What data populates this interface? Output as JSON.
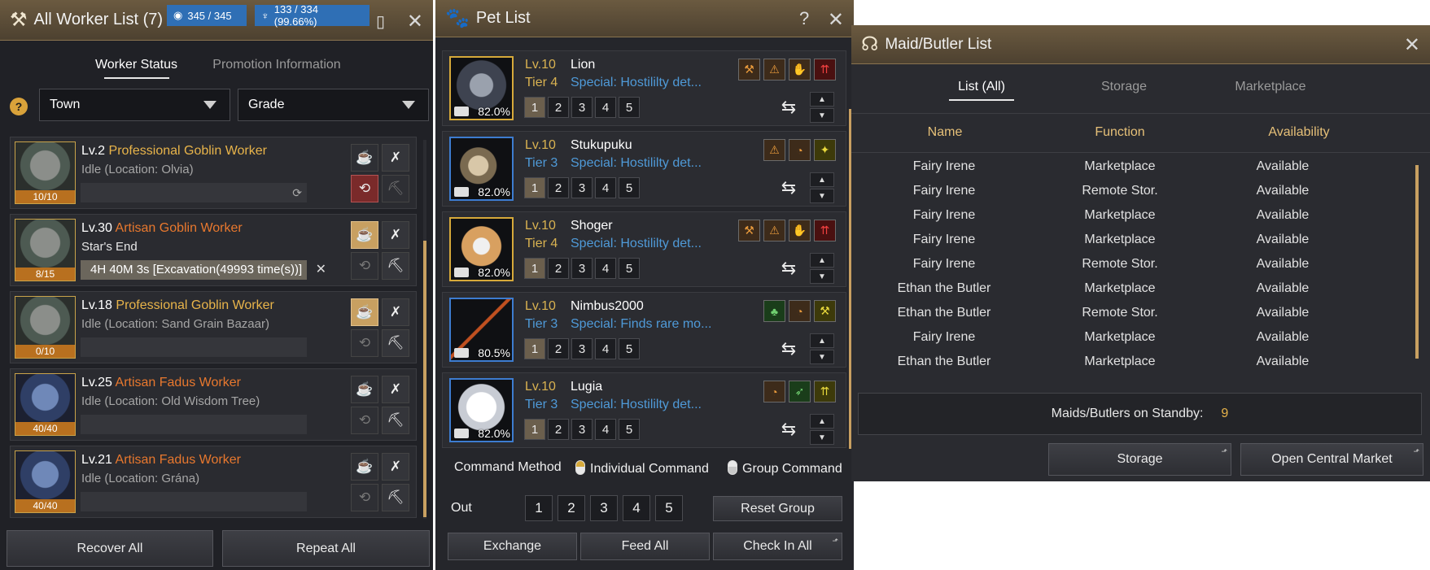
{
  "worker": {
    "title": "All Worker List (7)",
    "energy": "345 / 345",
    "stamina": "133 / 334 (99.66%)",
    "tabs": [
      "Worker Status",
      "Promotion Information"
    ],
    "filter_town": "Town",
    "filter_grade": "Grade",
    "help": "?",
    "rows": [
      {
        "lv": "Lv.2",
        "name": "Professional Goblin Worker",
        "status": "Idle (Location: Olvia)",
        "count": "10/10",
        "job": ""
      },
      {
        "lv": "Lv.30",
        "name": "Artisan Goblin Worker",
        "status": "Star's End",
        "count": "8/15",
        "job": "4H 40M 3s [Excavation(49993 time(s))]"
      },
      {
        "lv": "Lv.18",
        "name": "Professional Goblin Worker",
        "status": "Idle (Location: Sand Grain Bazaar)",
        "count": "0/10",
        "job": ""
      },
      {
        "lv": "Lv.25",
        "name": "Artisan Fadus Worker",
        "status": "Idle (Location: Old Wisdom Tree)",
        "count": "40/40",
        "job": ""
      },
      {
        "lv": "Lv.21",
        "name": "Artisan Fadus Worker",
        "status": "Idle (Location: Grána)",
        "count": "40/40",
        "job": ""
      }
    ],
    "recover_all": "Recover All",
    "repeat_all": "Repeat All"
  },
  "pet": {
    "title": "Pet List",
    "help": "?",
    "pets": [
      {
        "lv": "Lv.10",
        "name": "Lion",
        "tier": "Tier 4",
        "special": "Special: Hostililty det...",
        "pct": "82.0%"
      },
      {
        "lv": "Lv.10",
        "name": "Stukupuku",
        "tier": "Tier 3",
        "special": "Special: Hostililty det...",
        "pct": "82.0%"
      },
      {
        "lv": "Lv.10",
        "name": "Shoger",
        "tier": "Tier 4",
        "special": "Special: Hostililty det...",
        "pct": "82.0%"
      },
      {
        "lv": "Lv.10",
        "name": "Nimbus2000",
        "tier": "Tier 3",
        "special": "Special: Finds rare mo...",
        "pct": "80.5%"
      },
      {
        "lv": "Lv.10",
        "name": "Lugia",
        "tier": "Tier 3",
        "special": "Special: Hostililty det...",
        "pct": "82.0%"
      }
    ],
    "nums": [
      "1",
      "2",
      "3",
      "4",
      "5"
    ],
    "command_method": "Command Method",
    "individual": "Individual Command",
    "group": "Group Command",
    "out": "Out",
    "reset_group": "Reset Group",
    "exchange": "Exchange",
    "feed_all": "Feed All",
    "check_in_all": "Check In All"
  },
  "maid": {
    "title": "Maid/Butler List",
    "tabs": [
      "List (All)",
      "Storage",
      "Marketplace"
    ],
    "headers": [
      "Name",
      "Function",
      "Availability"
    ],
    "rows": [
      [
        "Fairy Irene",
        "Marketplace",
        "Available"
      ],
      [
        "Fairy Irene",
        "Remote Stor.",
        "Available"
      ],
      [
        "Fairy Irene",
        "Marketplace",
        "Available"
      ],
      [
        "Fairy Irene",
        "Marketplace",
        "Available"
      ],
      [
        "Fairy Irene",
        "Remote Stor.",
        "Available"
      ],
      [
        "Ethan the Butler",
        "Marketplace",
        "Available"
      ],
      [
        "Ethan the Butler",
        "Remote Stor.",
        "Available"
      ],
      [
        "Fairy Irene",
        "Marketplace",
        "Available"
      ],
      [
        "Ethan the Butler",
        "Marketplace",
        "Available"
      ]
    ],
    "standby_label": "Maids/Butlers on Standby:",
    "standby_count": "9",
    "storage_btn": "Storage",
    "market_btn": "Open Central Market"
  }
}
